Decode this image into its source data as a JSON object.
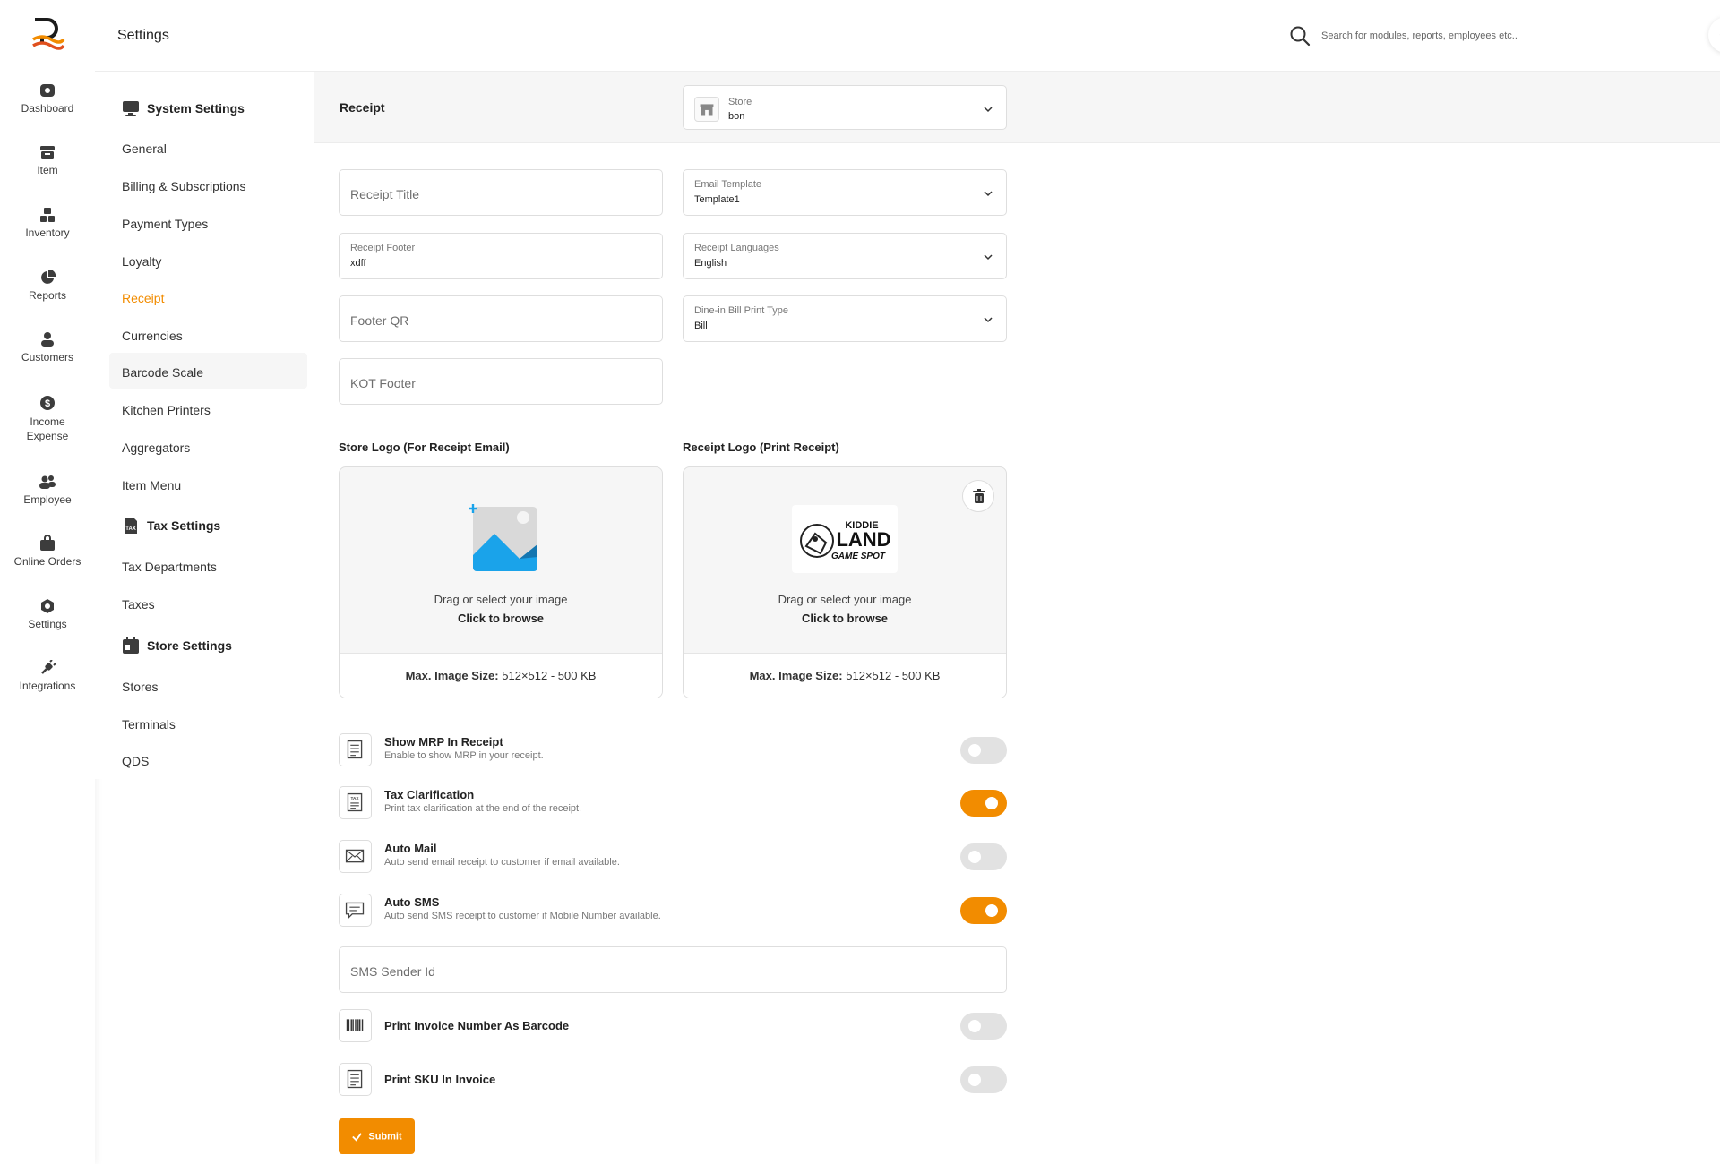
{
  "header": {
    "title": "Settings",
    "search_placeholder": "Search for modules, reports, employees etc.."
  },
  "rail": {
    "items": [
      {
        "label": "Dashboard",
        "icon": "dashboard-icon"
      },
      {
        "label": "Item",
        "icon": "item-icon"
      },
      {
        "label": "Inventory",
        "icon": "inventory-icon"
      },
      {
        "label": "Reports",
        "icon": "reports-icon"
      },
      {
        "label": "Customers",
        "icon": "customers-icon"
      },
      {
        "label": "Income Expense",
        "icon": "income-expense-icon"
      },
      {
        "label": "Employee",
        "icon": "employee-icon"
      },
      {
        "label": "Online Orders",
        "icon": "online-orders-icon"
      },
      {
        "label": "Settings",
        "icon": "settings-icon"
      },
      {
        "label": "Integrations",
        "icon": "integrations-icon"
      }
    ]
  },
  "menu": {
    "system_settings": "System Settings",
    "system_items": [
      "General",
      "Billing & Subscriptions",
      "Payment Types",
      "Loyalty",
      "Receipt",
      "Currencies",
      "Barcode Scale",
      "Kitchen Printers",
      "Aggregators",
      "Item Menu"
    ],
    "tax_settings": "Tax Settings",
    "tax_items": [
      "Tax Departments",
      "Taxes"
    ],
    "store_settings": "Store Settings",
    "store_items": [
      "Stores",
      "Terminals",
      "QDS"
    ],
    "active": "Receipt"
  },
  "receipt": {
    "heading": "Receipt",
    "store": {
      "label": "Store",
      "value": "bon"
    },
    "receipt_title_placeholder": "Receipt Title",
    "email_template": {
      "label": "Email Template",
      "value": "Template1"
    },
    "receipt_footer": {
      "label": "Receipt Footer",
      "value": "xdff"
    },
    "receipt_languages": {
      "label": "Receipt Languages",
      "value": "English"
    },
    "footer_qr_placeholder": "Footer QR",
    "dinein_print_type": {
      "label": "Dine-in Bill Print Type",
      "value": "Bill"
    },
    "kot_footer_placeholder": "KOT Footer",
    "store_logo_label": "Store Logo (For Receipt Email)",
    "receipt_logo_label": "Receipt Logo (Print Receipt)",
    "drag_text": "Drag or select your image",
    "browse_text": "Click to browse",
    "max_size_label": "Max. Image Size:",
    "max_size_value": "512×512 - 500 KB",
    "receipt_logo_text": [
      "KIDDIE",
      "LAND",
      "GAME SPOT"
    ],
    "sms_sender_placeholder": "SMS Sender Id",
    "submit_label": "Submit"
  },
  "toggles": [
    {
      "title": "Show MRP In Receipt",
      "desc": "Enable to show MRP in your receipt.",
      "on": false,
      "icon": "receipt-icon"
    },
    {
      "title": "Tax Clarification",
      "desc": "Print tax clarification at the end of the receipt.",
      "on": true,
      "icon": "tax-receipt-icon"
    },
    {
      "title": "Auto Mail",
      "desc": "Auto send email receipt to customer if email available.",
      "on": false,
      "icon": "mail-icon"
    },
    {
      "title": "Auto SMS",
      "desc": "Auto send SMS receipt to customer if Mobile Number available.",
      "on": true,
      "icon": "sms-icon"
    },
    {
      "title": "Print Invoice Number As Barcode",
      "desc": "",
      "on": false,
      "icon": "barcode-icon"
    },
    {
      "title": "Print SKU In Invoice",
      "desc": "",
      "on": false,
      "icon": "receipt-icon"
    }
  ],
  "colors": {
    "accent": "#f28c00",
    "toggle_off": "#e2e2e2",
    "brand_dark": "#1b1b1b"
  }
}
